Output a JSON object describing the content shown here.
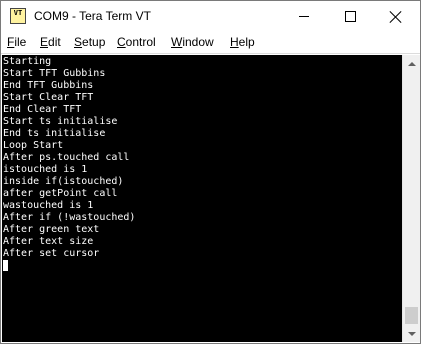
{
  "window": {
    "title": "COM9 - Tera Term VT",
    "icon_label": "VT"
  },
  "menu": {
    "file": {
      "accel": "F",
      "rest": "ile"
    },
    "edit": {
      "accel": "E",
      "rest": "dit"
    },
    "setup": {
      "accel": "S",
      "rest": "etup"
    },
    "control": {
      "accel": "C",
      "rest": "ontrol"
    },
    "window": {
      "accel": "W",
      "rest": "indow"
    },
    "help": {
      "accel": "H",
      "rest": "elp"
    }
  },
  "terminal": {
    "lines": [
      "Starting",
      "Start TFT Gubbins",
      "End TFT Gubbins",
      "Start Clear TFT",
      "End Clear TFT",
      "Start ts initialise",
      "End ts initialise",
      "Loop Start",
      "After ps.touched call",
      "istouched is 1",
      "inside if(istouched)",
      "after getPoint call",
      "wastouched is 1",
      "After if (!wastouched)",
      "After green text",
      "After text size",
      "After set cursor"
    ]
  },
  "colors": {
    "terminal_bg": "#000000",
    "terminal_fg": "#ffffff"
  }
}
